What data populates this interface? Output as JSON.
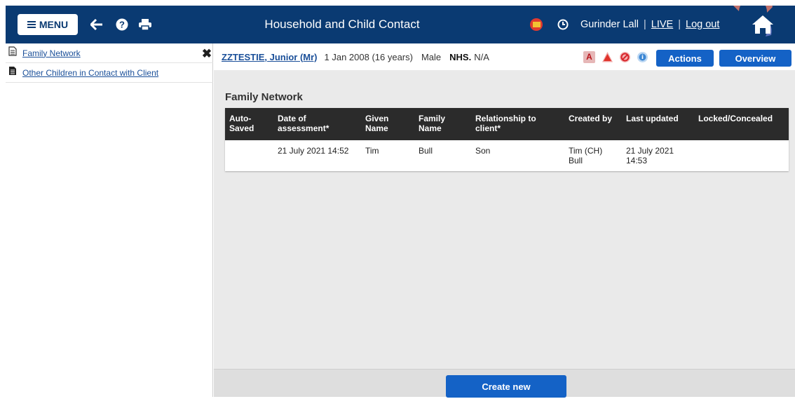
{
  "header": {
    "menu_label": "MENU",
    "title": "Household and Child Contact",
    "user_name": "Gurinder Lall",
    "environment": "LIVE",
    "logout_label": "Log out",
    "bar_color": "#0a3a72"
  },
  "sidebar": {
    "items": [
      {
        "label": "Family Network",
        "icon": "document-outline-icon"
      },
      {
        "label": "Other Children in Contact with Client",
        "icon": "document-filled-icon"
      }
    ]
  },
  "client": {
    "name": "ZZTESTIE, Junior (Mr)",
    "dob": "1 Jan 2008 (16 years)",
    "sex": "Male",
    "nhs_label": "NHS.",
    "nhs_value": "N/A",
    "flag_a": "A",
    "actions_label": "Actions",
    "overview_label": "Overview"
  },
  "main": {
    "section_title": "Family Network",
    "columns": [
      "Auto-Saved",
      "Date of assessment*",
      "Given Name",
      "Family Name",
      "Relationship to client*",
      "Created by",
      "Last updated",
      "Locked/Concealed"
    ],
    "rows": [
      {
        "auto_saved": "",
        "date": "21 July 2021 14:52",
        "given": "Tim",
        "family": "Bull",
        "relationship": "Son",
        "created_by": "Tim (CH) Bull",
        "last_updated": "21 July 2021 14:53",
        "locked": ""
      }
    ],
    "create_label": "Create new"
  },
  "colors": {
    "accent": "#1462c6",
    "table_header": "#2b2b2b",
    "link": "#1a4f99"
  }
}
